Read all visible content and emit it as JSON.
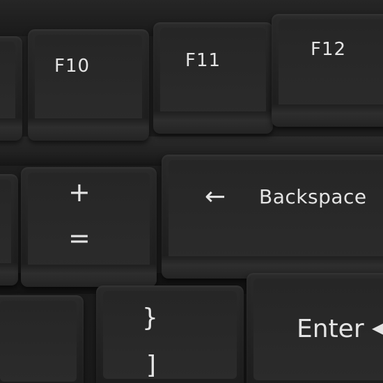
{
  "keyboard": {
    "function_row": {
      "f10": "F10",
      "f11": "F11",
      "f12": "F12"
    },
    "number_row": {
      "plus_equals_top": "+",
      "plus_equals_bottom": "=",
      "backspace_arrow": "←",
      "backspace_label": "Backspace"
    },
    "home_row": {
      "brace_top": "}",
      "brace_bottom": "]",
      "enter_label": "Enter",
      "enter_arrow": "◂"
    }
  },
  "colors": {
    "key_body": "#242424",
    "legend": "#e4e4e4",
    "background": "#1c1c1c"
  }
}
